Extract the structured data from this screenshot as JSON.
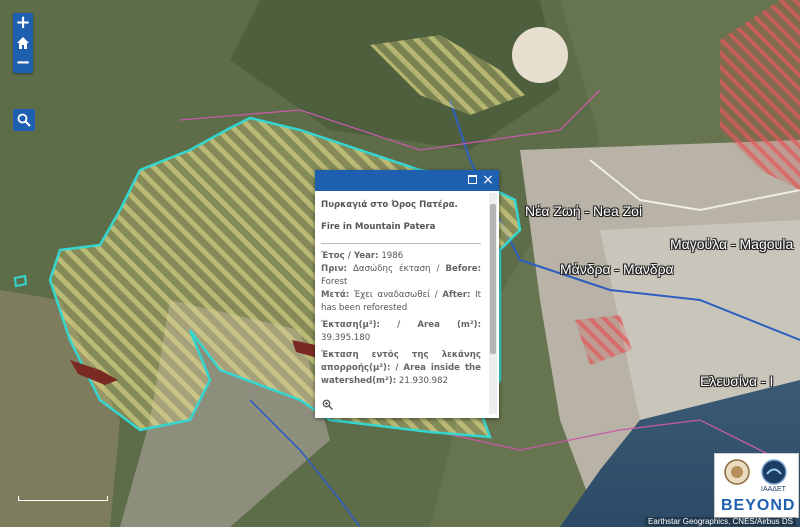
{
  "controls": {
    "zoom_in": "+",
    "home": "home",
    "zoom_out": "−"
  },
  "places": [
    {
      "name": "Νέα Ζωή - Nea Zoi"
    },
    {
      "name": "Μαγούλα - Magoula"
    },
    {
      "name": "Μάνδρα - Μανδρα"
    },
    {
      "name": "Ελευσίνα - Ι"
    }
  ],
  "popup": {
    "title_gr": "Πυρκαγιά στο Όρος Πατέρα.",
    "title_en": "Fire in Mountain Patera",
    "year_label": "Έτος / Year:",
    "year_value": "1986",
    "before_label": "Πριν:",
    "before_value": "Δασώδης έκταση /",
    "before_label_en": "Before:",
    "before_value_en": "Forest",
    "after_label": "Μετά:",
    "after_value": "Έχει αναδασωθεί /",
    "after_label_en": "After:",
    "after_value_en": "It has been reforested",
    "area_label": "Έκταση(μ²): / Area (m²):",
    "area_value": "39.395.180",
    "watershed_label": "Έκταση εντός της λεκάνης απορροής(μ²): / Area inside the watershed(m²):",
    "watershed_value": "21.930.982"
  },
  "logo": {
    "org": "ΙΑΑΔΕΤ",
    "text": "BEYOND"
  },
  "attribution": "Earthstar Geographics, CNES/Airbus DS",
  "colors": {
    "accent": "#1f5fb0",
    "fire_outline": "#35d6d0",
    "hatch": "#d9d27a"
  }
}
